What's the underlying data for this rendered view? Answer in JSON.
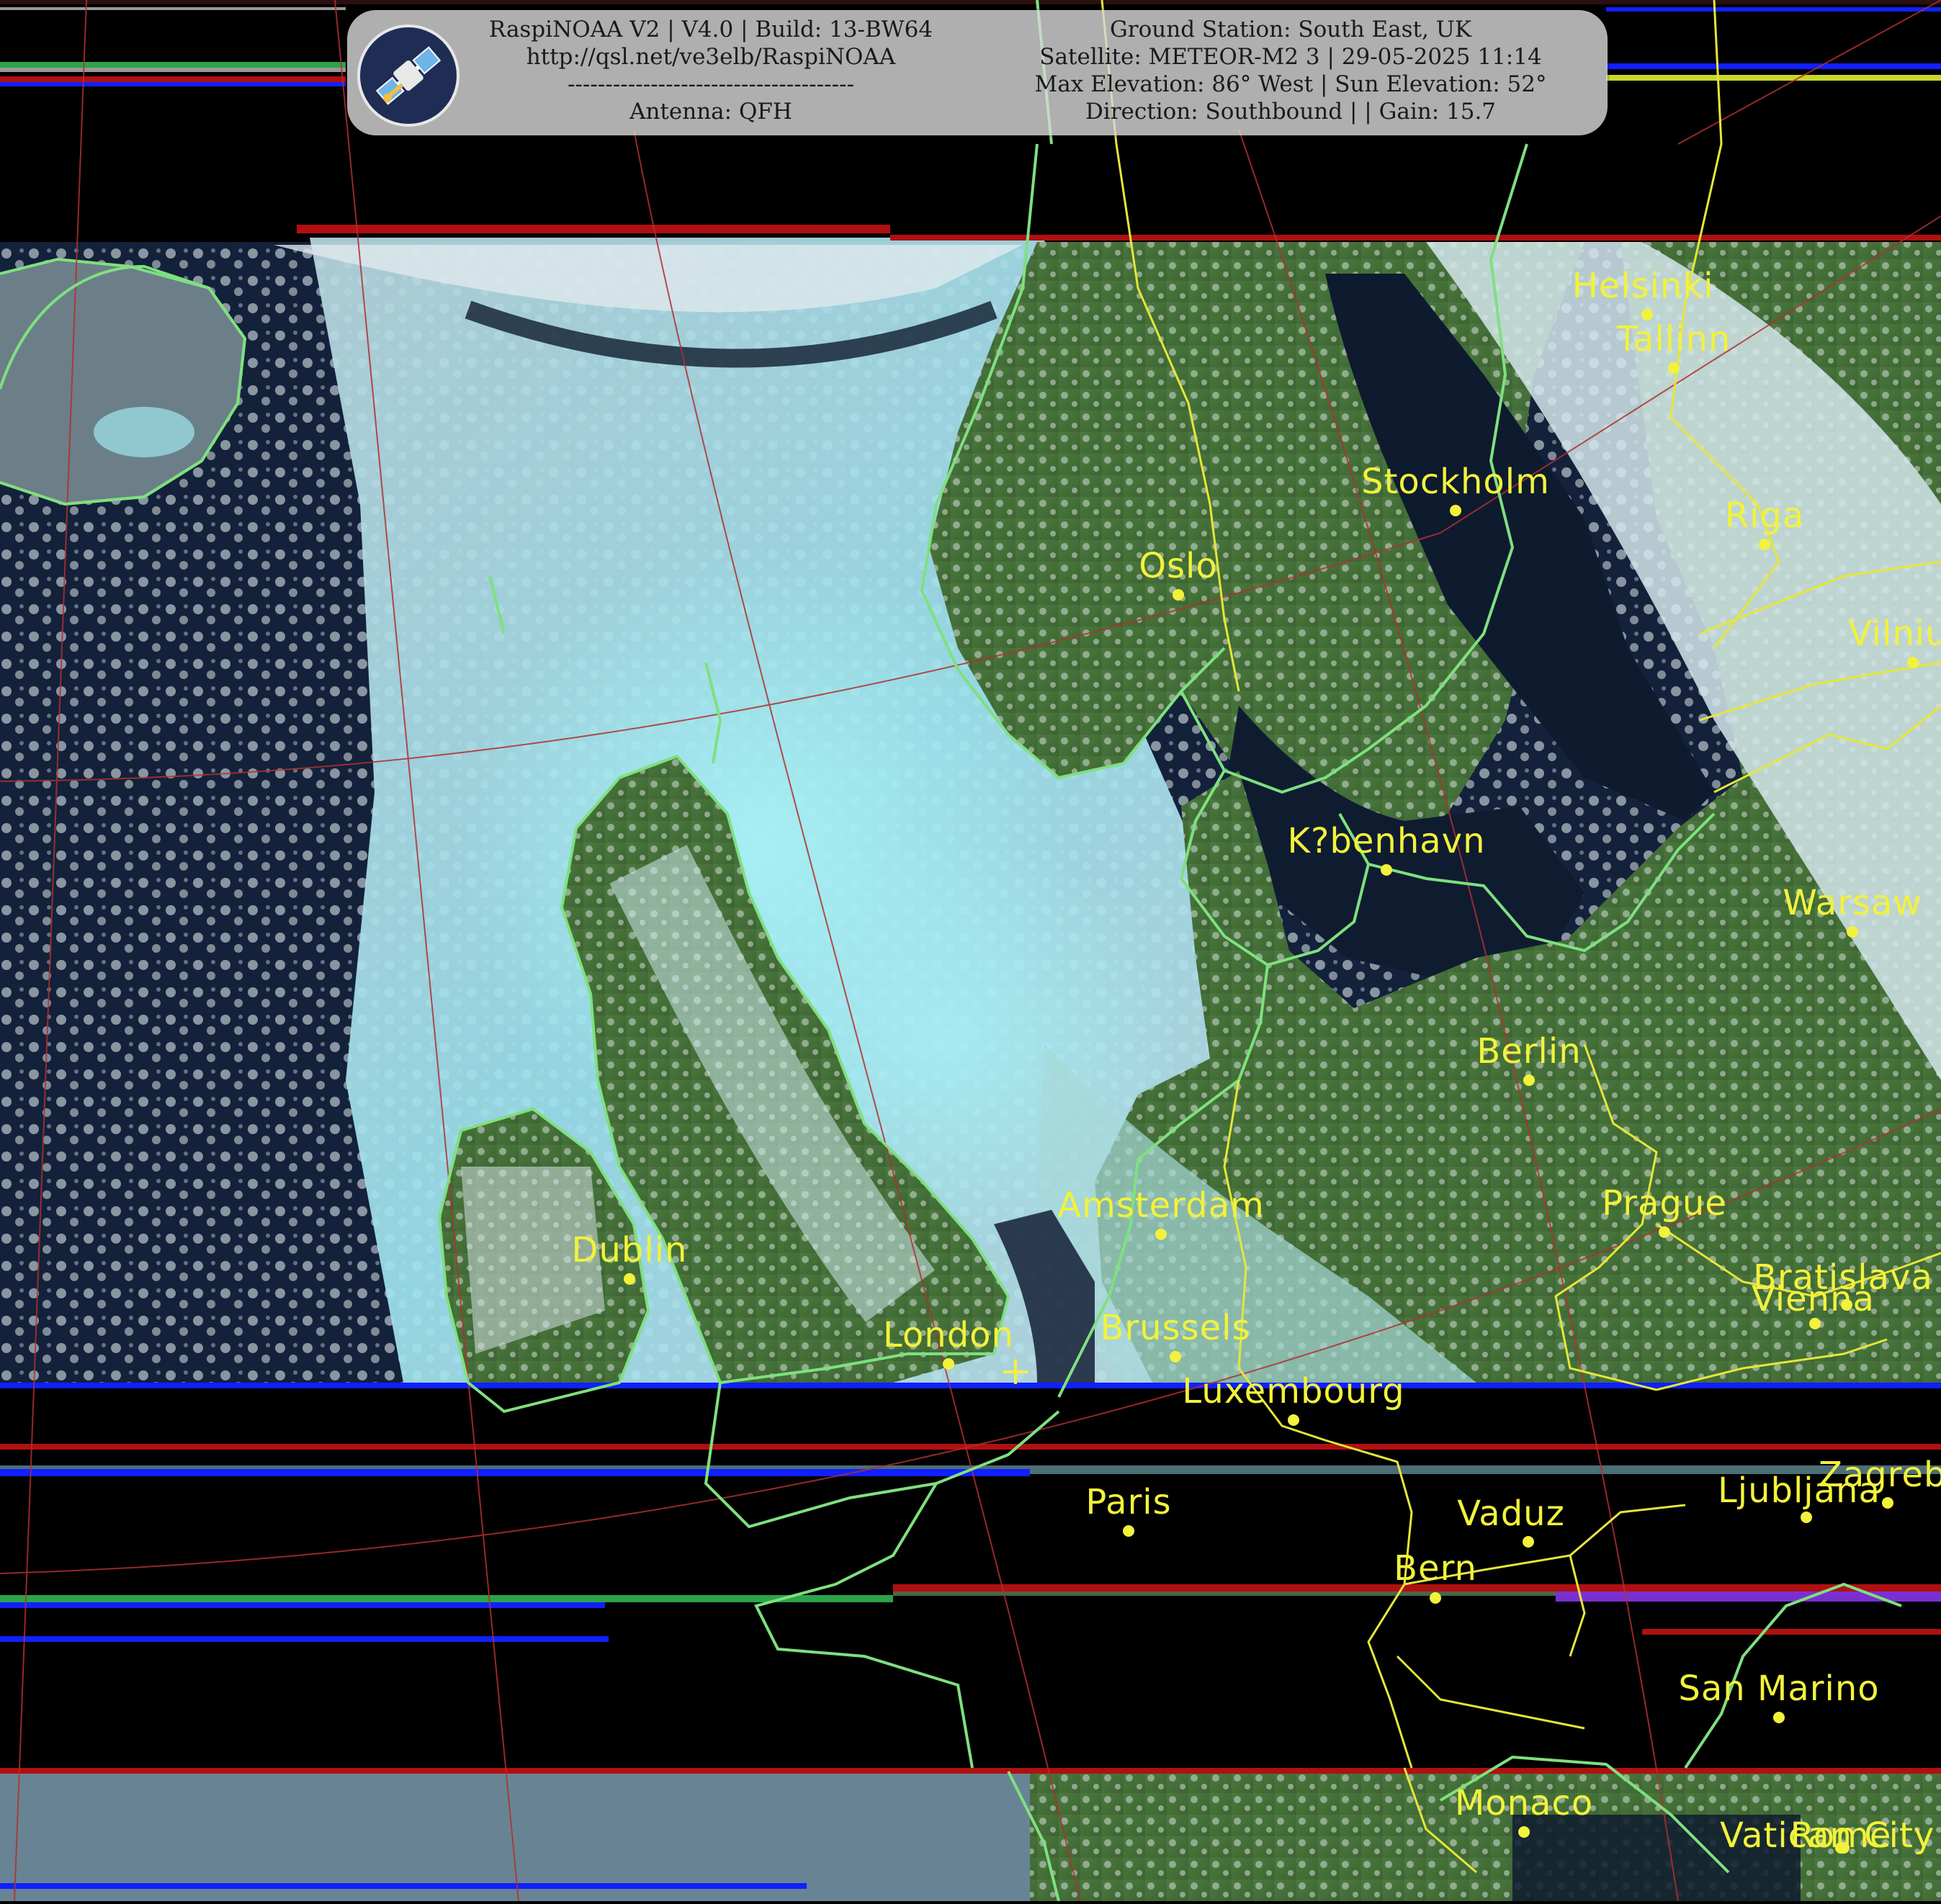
{
  "header": {
    "left_lines": [
      "RaspiNOAA V2 | V4.0 | Build: 13-BW64",
      "http://qsl.net/ve3elb/RaspiNOAA",
      "--------------------------------------",
      "Antenna: QFH"
    ],
    "right_lines": [
      "Ground Station: South East, UK",
      "Satellite: METEOR-M2 3 | 29-05-2025 11:14",
      "Max Elevation: 86° West | Sun Elevation: 52°",
      "Direction: Southbound | | Gain: 15.7"
    ]
  },
  "icons": {
    "logo": "satellite-icon",
    "station_marker": "plus-marker-icon"
  },
  "colors": {
    "city_label": "#f2f23c",
    "coastline": "#7fe07f",
    "border": "#e6e63a",
    "graticule": "#b03030",
    "sea": "#0e1a2e",
    "cloud": "#bfe8ee",
    "land": "#3f6a35"
  },
  "cities": [
    {
      "name": "Helsinki"
    },
    {
      "name": "Tallinn"
    },
    {
      "name": "Stockholm"
    },
    {
      "name": "Riga"
    },
    {
      "name": "Oslo"
    },
    {
      "name": "Vilnius"
    },
    {
      "name": "K?benhavn"
    },
    {
      "name": "Warsaw"
    },
    {
      "name": "Berlin"
    },
    {
      "name": "Amsterdam"
    },
    {
      "name": "Prague"
    },
    {
      "name": "Dublin"
    },
    {
      "name": "Bratislava"
    },
    {
      "name": "Vienna"
    },
    {
      "name": "London"
    },
    {
      "name": "Brussels"
    },
    {
      "name": "Luxembourg"
    },
    {
      "name": "Paris"
    },
    {
      "name": "Vaduz"
    },
    {
      "name": "Ljubljana"
    },
    {
      "name": "Zagreb"
    },
    {
      "name": "Bern"
    },
    {
      "name": "San Marino"
    },
    {
      "name": "Monaco"
    },
    {
      "name": "Vatican City"
    },
    {
      "name": "Rome"
    }
  ]
}
